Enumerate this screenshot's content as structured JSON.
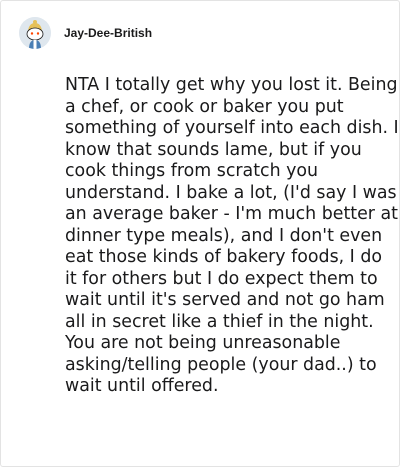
{
  "post": {
    "username": "Jay-Dee-British",
    "avatar_icon": "reddit-snoo-avatar-icon",
    "comment_text": "NTA I totally get why you lost it. Being a chef, or cook or baker you put something of yourself into each dish. I know that sounds lame, but if you cook things from scratch you understand. I bake a lot, (I'd say I was an average baker - I'm much better at dinner type meals), and I don't even eat those kinds of bakery foods, I do it for others but I do expect them to wait until it's served and not go ham all in secret like a thief in the night. You are not being unreasonable asking/telling people (your dad..) to wait until offered."
  },
  "colors": {
    "text": "#1a1a1b",
    "border": "#e3e3e3",
    "avatar_bg": "#dfe7ee"
  }
}
